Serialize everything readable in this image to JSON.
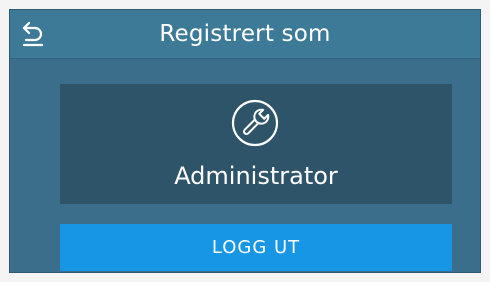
{
  "header": {
    "title": "Registrert som",
    "back_icon": "back-arrow-icon"
  },
  "user": {
    "role": "Administrator",
    "icon": "wrench-icon"
  },
  "actions": {
    "logout_label": "LOGG UT"
  },
  "colors": {
    "screen_bg": "#3a6e8a",
    "header_bg": "#3d7a97",
    "panel_bg": "#2d5468",
    "button_bg": "#1896e6",
    "text": "#ffffff"
  }
}
